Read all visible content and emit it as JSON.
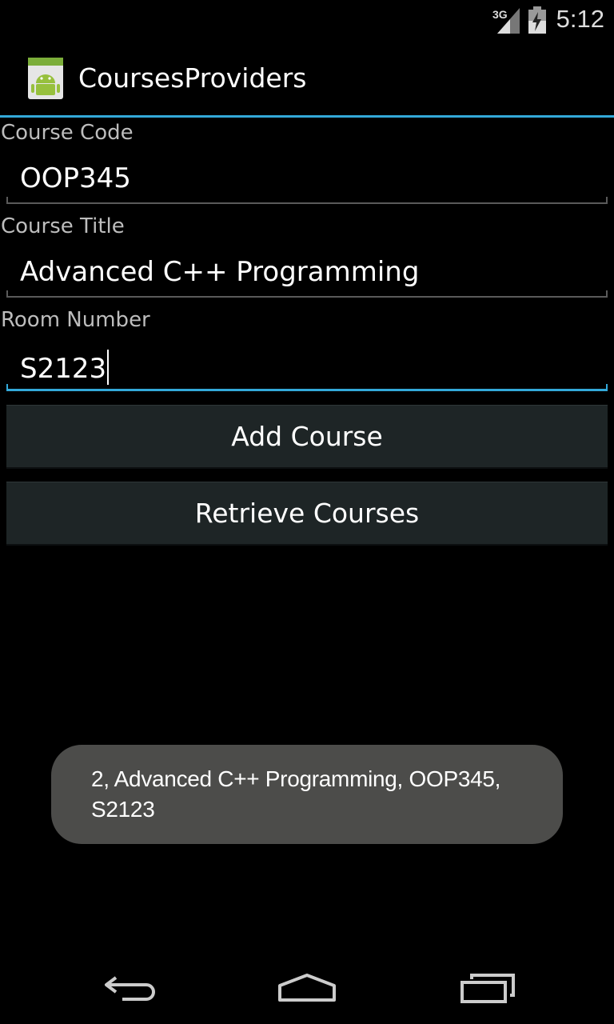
{
  "status_bar": {
    "time": "5:12",
    "network_label": "3G",
    "icons": [
      "signal-icon",
      "battery-icon"
    ]
  },
  "action_bar": {
    "app_title": "CoursesProviders",
    "app_icon": "android-app-icon"
  },
  "form": {
    "course_code": {
      "label": "Course Code",
      "value": "OOP345"
    },
    "course_title": {
      "label": "Course Title",
      "value": "Advanced C++ Programming"
    },
    "room_number": {
      "label": "Room Number",
      "value": "S2123"
    }
  },
  "buttons": {
    "add_course": "Add Course",
    "retrieve_courses": "Retrieve Courses"
  },
  "toast": {
    "line1": "2, Advanced C++ Programming, OOP345,",
    "line2": "S2123"
  },
  "nav_bar": {
    "icons": [
      "back-icon",
      "home-icon",
      "recent-apps-icon"
    ]
  },
  "colors": {
    "accent": "#33a9d9",
    "button_bg": "#1e2526",
    "toast_bg": "#4c4c4a"
  }
}
